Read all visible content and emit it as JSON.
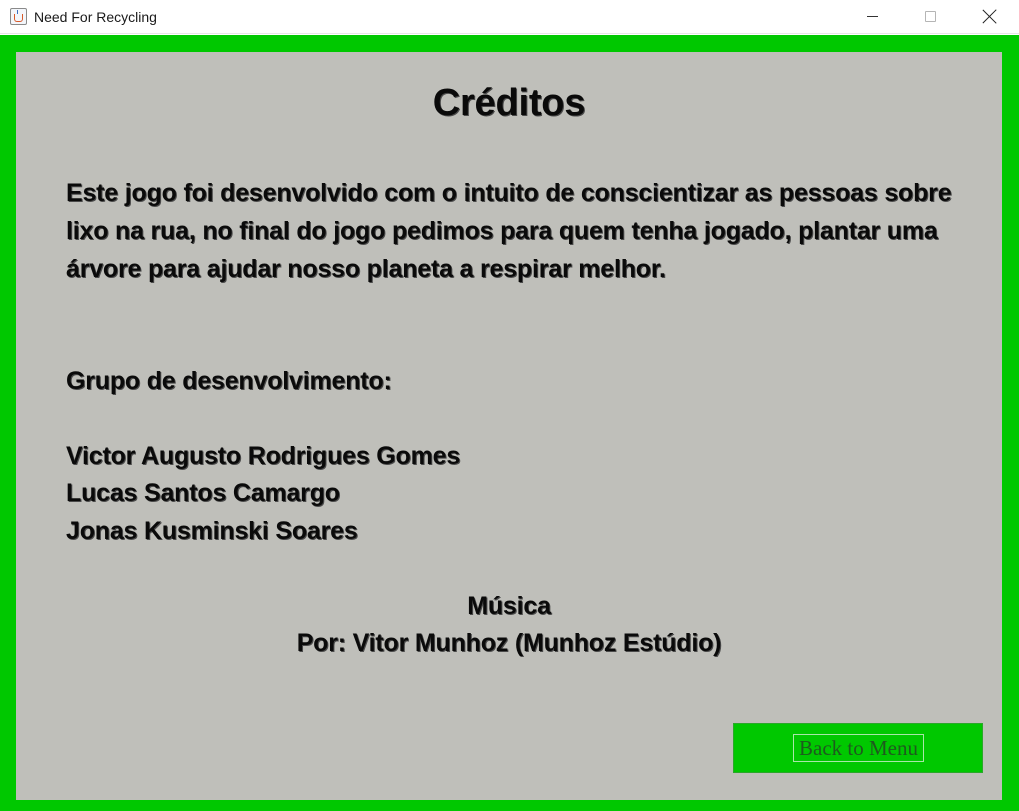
{
  "window": {
    "title": "Need For Recycling",
    "app_icon": "java-cup-icon",
    "controls": [
      "minimize-icon",
      "maximize-icon",
      "close-icon"
    ]
  },
  "colors": {
    "frame": "#00c800",
    "panel": "#bfbfba",
    "button": "#00c800",
    "text": "#0a0a0a"
  },
  "credits": {
    "heading": "Créditos",
    "description": "Este jogo foi desenvolvido com o intuito de conscientizar as pessoas sobre lixo na rua, no final do jogo pedimos para quem tenha jogado, plantar uma árvore para ajudar nosso planeta a respirar melhor.",
    "group_label": "Grupo de desenvolvimento:",
    "members": [
      "Victor Augusto Rodrigues Gomes",
      "Lucas Santos Camargo",
      "Jonas Kusminski Soares"
    ],
    "music_title": "Música",
    "music_credit": "Por: Vitor Munhoz (Munhoz Estúdio)"
  },
  "back_button": {
    "label": "Back to Menu"
  }
}
